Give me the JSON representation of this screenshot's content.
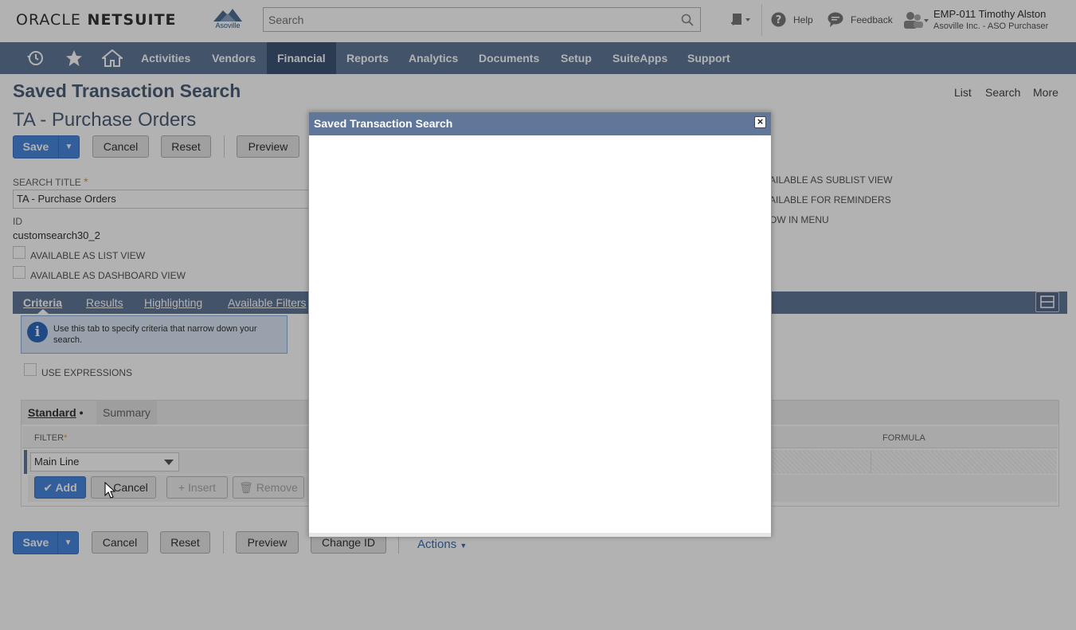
{
  "header": {
    "brand": "ORACLE",
    "brand_product": "NETSUITE",
    "company_logo_text": "Asoville",
    "search_placeholder": "Search",
    "help_label": "Help",
    "feedback_label": "Feedback",
    "user_name": "EMP-011 Timothy Alston",
    "user_role": "Asoville Inc. - ASO Purchaser"
  },
  "nav": {
    "items": [
      "Activities",
      "Vendors",
      "Financial",
      "Reports",
      "Analytics",
      "Documents",
      "Setup",
      "SuiteApps",
      "Support"
    ],
    "active": "Financial"
  },
  "page": {
    "title": "Saved Transaction Search",
    "record_title": "TA - Purchase Orders",
    "links": [
      "List",
      "Search",
      "More"
    ]
  },
  "buttons": {
    "save": "Save",
    "cancel": "Cancel",
    "reset": "Reset",
    "preview": "Preview",
    "change_id": "Change ID",
    "actions": "Actions"
  },
  "form": {
    "search_title_label": "SEARCH TITLE",
    "search_title_value": "TA - Purchase Orders",
    "id_label": "ID",
    "id_value": "customsearch30_2",
    "available_list_view": "AVAILABLE AS LIST VIEW",
    "available_dashboard_view": "AVAILABLE AS DASHBOARD VIEW",
    "available_sublist_view": "AILABLE AS SUBLIST VIEW",
    "available_reminders": "AILABLE FOR REMINDERS",
    "show_in_menu": "OW IN MENU"
  },
  "tabs": {
    "items": [
      "Criteria",
      "Results",
      "Highlighting",
      "Available Filters"
    ],
    "active": "Criteria"
  },
  "info": {
    "text": "Use this tab to specify criteria that narrow down your search."
  },
  "criteria": {
    "use_expressions": "USE EXPRESSIONS",
    "subtab_standard": "Standard",
    "subtab_summary": "Summary",
    "filter_header": "FILTER",
    "formula_header": "FORMULA",
    "filter_value": "Main Line",
    "add": "Add",
    "cancel": "Cancel",
    "insert": "Insert",
    "remove": "Remove"
  },
  "modal": {
    "title": "Saved Transaction Search",
    "close": "×"
  }
}
